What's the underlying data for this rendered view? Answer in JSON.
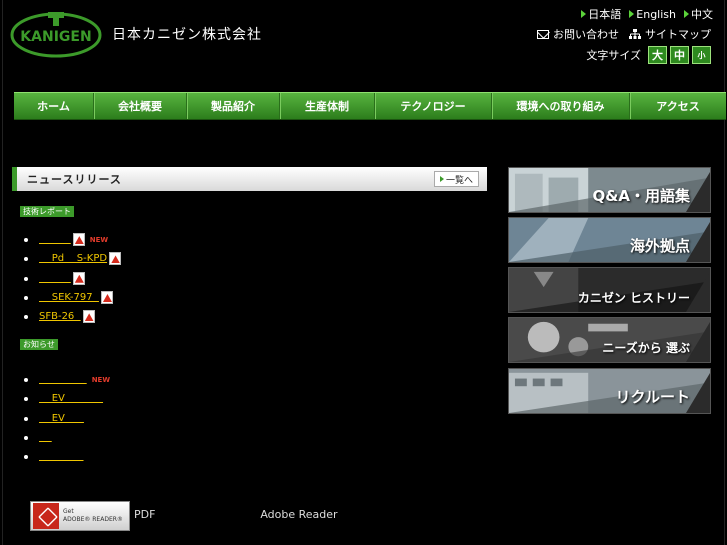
{
  "header": {
    "logo_text": "KANIGEN",
    "company_name": "日本カニゼン株式会社",
    "languages": [
      "日本語",
      "English",
      "中文"
    ],
    "contact_label": "お問い合わせ",
    "sitemap_label": "サイトマップ",
    "fontsize_label": "文字サイズ",
    "fontsize_large": "大",
    "fontsize_medium": "中",
    "fontsize_small": "小"
  },
  "nav": {
    "items": [
      "ホーム",
      "会社概要",
      "製品紹介",
      "生産体制",
      "テクノロジー",
      "環境への取り組み",
      "アクセス"
    ]
  },
  "news": {
    "title": "ニュースリリース",
    "list_all": "一覧へ",
    "tech_report_label": "技術レポート",
    "tech_reports": [
      {
        "text": "          ",
        "new": "NEW"
      },
      {
        "text": "    Pd    S-KPD",
        "new": ""
      },
      {
        "text": "          ",
        "new": ""
      },
      {
        "text": "    SEK-797  ",
        "new": ""
      },
      {
        "text": "SFB-26  ",
        "new": ""
      }
    ],
    "notice_label": "お知らせ",
    "notices": [
      {
        "text": "               ",
        "new": "NEW"
      },
      {
        "text": "    EV            ",
        "new": ""
      },
      {
        "text": "    EV      ",
        "new": ""
      },
      {
        "text": "    ",
        "new": ""
      },
      {
        "text": "              ",
        "new": ""
      }
    ]
  },
  "banners": [
    {
      "label": "Q&A・用語集"
    },
    {
      "label": "海外拠点"
    },
    {
      "label": "カニゼン ヒストリー"
    },
    {
      "label": "ニーズから 選ぶ"
    },
    {
      "label": "リクルート"
    }
  ],
  "footer": {
    "reader_get": "Get",
    "reader_name": "ADOBE® READER®",
    "note": "PDF                              Adobe Reader"
  },
  "colors": {
    "accent": "#3c9a2a",
    "link": "#f0c600",
    "new": "#e23b2b"
  }
}
